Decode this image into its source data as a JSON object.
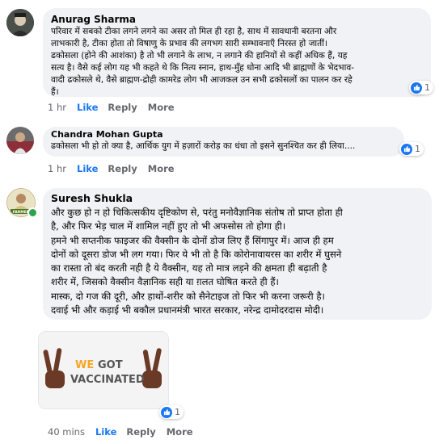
{
  "comments": [
    {
      "author": "Anurag Sharma",
      "text": "परिवार में सबको टीका लगने लगने का असर तो मिल ही रहा है, साथ में सावधानी बरतना और\nलाभकारी है, टीका होता तो विषाणु के प्रभाव की लगभग सारी सम्भावनाएँ निरस्त हो जातीं।\nढकोसला (होने की आशंका) है तो भी लगाने के लाभ, न लगाने की हानियों से कहीं अधिक हैं, यह\nसत्य है। वैसे कई लोग यह भी कहते थे कि नित्य स्नान, हाथ-मुँह धोना आदि भी ब्राह्मणों के भेदभाव-\nवादी ढकोसले थे, वैसे ब्राह्मण-द्रोही कामरेड लोग भी आजकल उन सभी ढकोसलों का पालन कर रहे\nहैं।",
      "reaction_count": "1",
      "time": "1 hr",
      "like": "Like",
      "reply": "Reply",
      "more": "More"
    },
    {
      "author": "Chandra Mohan Gupta",
      "text": "ढकोसला भी हो तो क्या है, आर्थिक युग में हज़ारों करोड़ का धंधा तो इसने सुनश्चित कर ही लिया....",
      "reaction_count": "1",
      "time": "1 hr",
      "like": "Like",
      "reply": "Reply",
      "more": "More"
    },
    {
      "author": "Suresh Shukla",
      "text": "और कुछ हो न हो चिकित्सकीय दृष्टिकोण से, परंतु मनोवैज्ञानिक संतोष तो प्राप्त होता ही\nहै, और फिर भेड़ चाल में शामिल नहीं हुए तो भी अफसोस तो होगा ही।\nहमने भी सप्तनीक फाइजर की वैक्सीन के दोनों डोज लिए हैं सिंगापुर में। आज ही हम\nदोनों को दूसरा डोज भी लग गया। फिर ये भी तो है कि कोरोनावायरस का शरीर में घुसने\nका रास्ता तो बंद करती नही है ये वैक्सीन, यह तो मात्र लड़ने की क्षमता ही बढ़ाती है\nशरीर में, जिसको वैक्सीन वैज्ञानिक सही या ग़लत घोषित करते ही हैं।\nमास्क, दो गज की दूरी, और हाथों-शरीर को सैनेटाइज तो फिर भी करना जरूरी है।\nदवाई भी और कड़ाई भी बकौल प्रधानमंत्री भारत सरकार, नरेन्द्र दामोदरदास मोदी।",
      "avatar_badge": "FARMER",
      "image_text_1": "WE",
      "image_text_2": "GOT",
      "image_text_3": "VACCINATED",
      "reaction_count": "1",
      "time": "40 mins",
      "like": "Like",
      "reply": "Reply",
      "more": "More"
    }
  ],
  "colors": {
    "link_blue": "#1877f2",
    "bubble": "#f0f2f5",
    "meta_gray": "#65676b",
    "accent_orange": "#f5a623"
  }
}
